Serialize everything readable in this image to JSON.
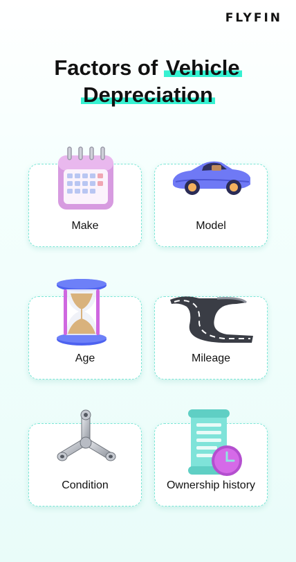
{
  "brand": {
    "logo_text": "FLYFIN"
  },
  "title": {
    "line1_plain": "Factors of ",
    "line1_highlight": "Vehicle",
    "line2_highlight": "Depreciation"
  },
  "factors": [
    {
      "label": "Make",
      "icon": "calendar-icon"
    },
    {
      "label": "Model",
      "icon": "car-icon"
    },
    {
      "label": "Age",
      "icon": "hourglass-icon"
    },
    {
      "label": "Mileage",
      "icon": "road-icon"
    },
    {
      "label": "Condition",
      "icon": "wrench-icon"
    },
    {
      "label": "Ownership history",
      "icon": "scroll-clock-icon"
    }
  ],
  "colors": {
    "accent": "#36f1d1",
    "card_border": "#79e6d6",
    "calendar": "#e4a6e8",
    "car": "#6f79f5",
    "clock": "#c85ce0"
  }
}
